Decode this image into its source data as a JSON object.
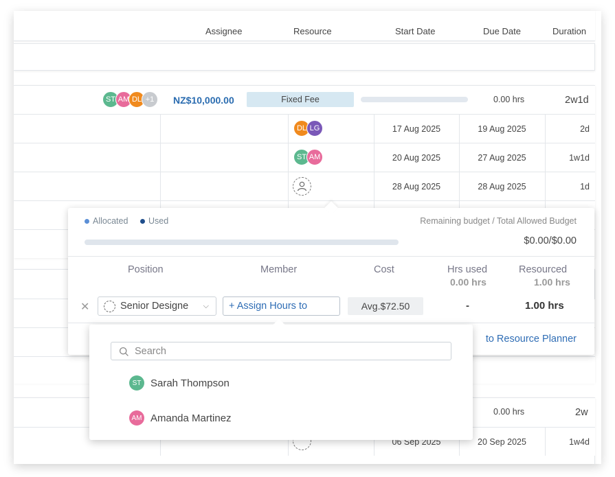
{
  "header": {
    "columns": [
      "Assignee",
      "Resource",
      "Start Date",
      "Due Date",
      "Duration"
    ]
  },
  "summary_row": {
    "avatars": [
      {
        "initials": "ST",
        "color": "#5cb88f"
      },
      {
        "initials": "AM",
        "color": "#e86b9b"
      },
      {
        "initials": "DL",
        "color": "#f08a1e"
      },
      {
        "initials": "+1",
        "color": "#c8cbcf"
      }
    ],
    "amount": "NZ$10,000.00",
    "billing_type": "Fixed Fee",
    "hours": "0.00 hrs",
    "duration": "2w1d"
  },
  "task_rows": [
    {
      "avatars": [
        {
          "initials": "DL",
          "color": "#f08a1e"
        },
        {
          "initials": "LG",
          "color": "#7a58b8"
        }
      ],
      "start": "17 Aug 2025",
      "due": "19 Aug 2025",
      "duration": "2d"
    },
    {
      "avatars": [
        {
          "initials": "ST",
          "color": "#5cb88f"
        },
        {
          "initials": "AM",
          "color": "#e86b9b"
        }
      ],
      "start": "20 Aug 2025",
      "due": "27 Aug 2025",
      "duration": "1w1d"
    },
    {
      "avatars": [],
      "start": "28 Aug 2025",
      "due": "28 Aug 2025",
      "duration": "1d"
    }
  ],
  "lower_row": {
    "hours": "0.00 hrs",
    "duration": "2w"
  },
  "lower_task_row": {
    "start": "06 Sep 2025",
    "due": "20 Sep 2025",
    "duration": "1w4d"
  },
  "popover": {
    "legend_allocated": "Allocated",
    "legend_used": "Used",
    "budget_label": "Remaining budget / Total Allowed Budget",
    "budget_value": "$0.00/$0.00",
    "col_position": "Position",
    "col_member": "Member",
    "col_cost": "Cost",
    "col_hrs_used": "Hrs used",
    "col_hrs_used_total": "0.00 hrs",
    "col_resourced": "Resourced",
    "col_resourced_total": "1.00 hrs",
    "position_value": "Senior Designe",
    "member_button": "+ Assign Hours to",
    "cost_value": "Avg.$72.50",
    "hrs_used_value": "-",
    "resourced_value": "1.00 hrs",
    "planner_link": "to Resource Planner",
    "colors": {
      "allocated": "#5b8fd6",
      "used": "#1f4e8c",
      "link": "#2f6db5"
    }
  },
  "dropdown": {
    "search_placeholder": "Search",
    "members": [
      {
        "initials": "ST",
        "name": "Sarah Thompson",
        "color": "#5cb88f"
      },
      {
        "initials": "AM",
        "name": "Amanda Martinez",
        "color": "#e86b9b"
      }
    ]
  }
}
